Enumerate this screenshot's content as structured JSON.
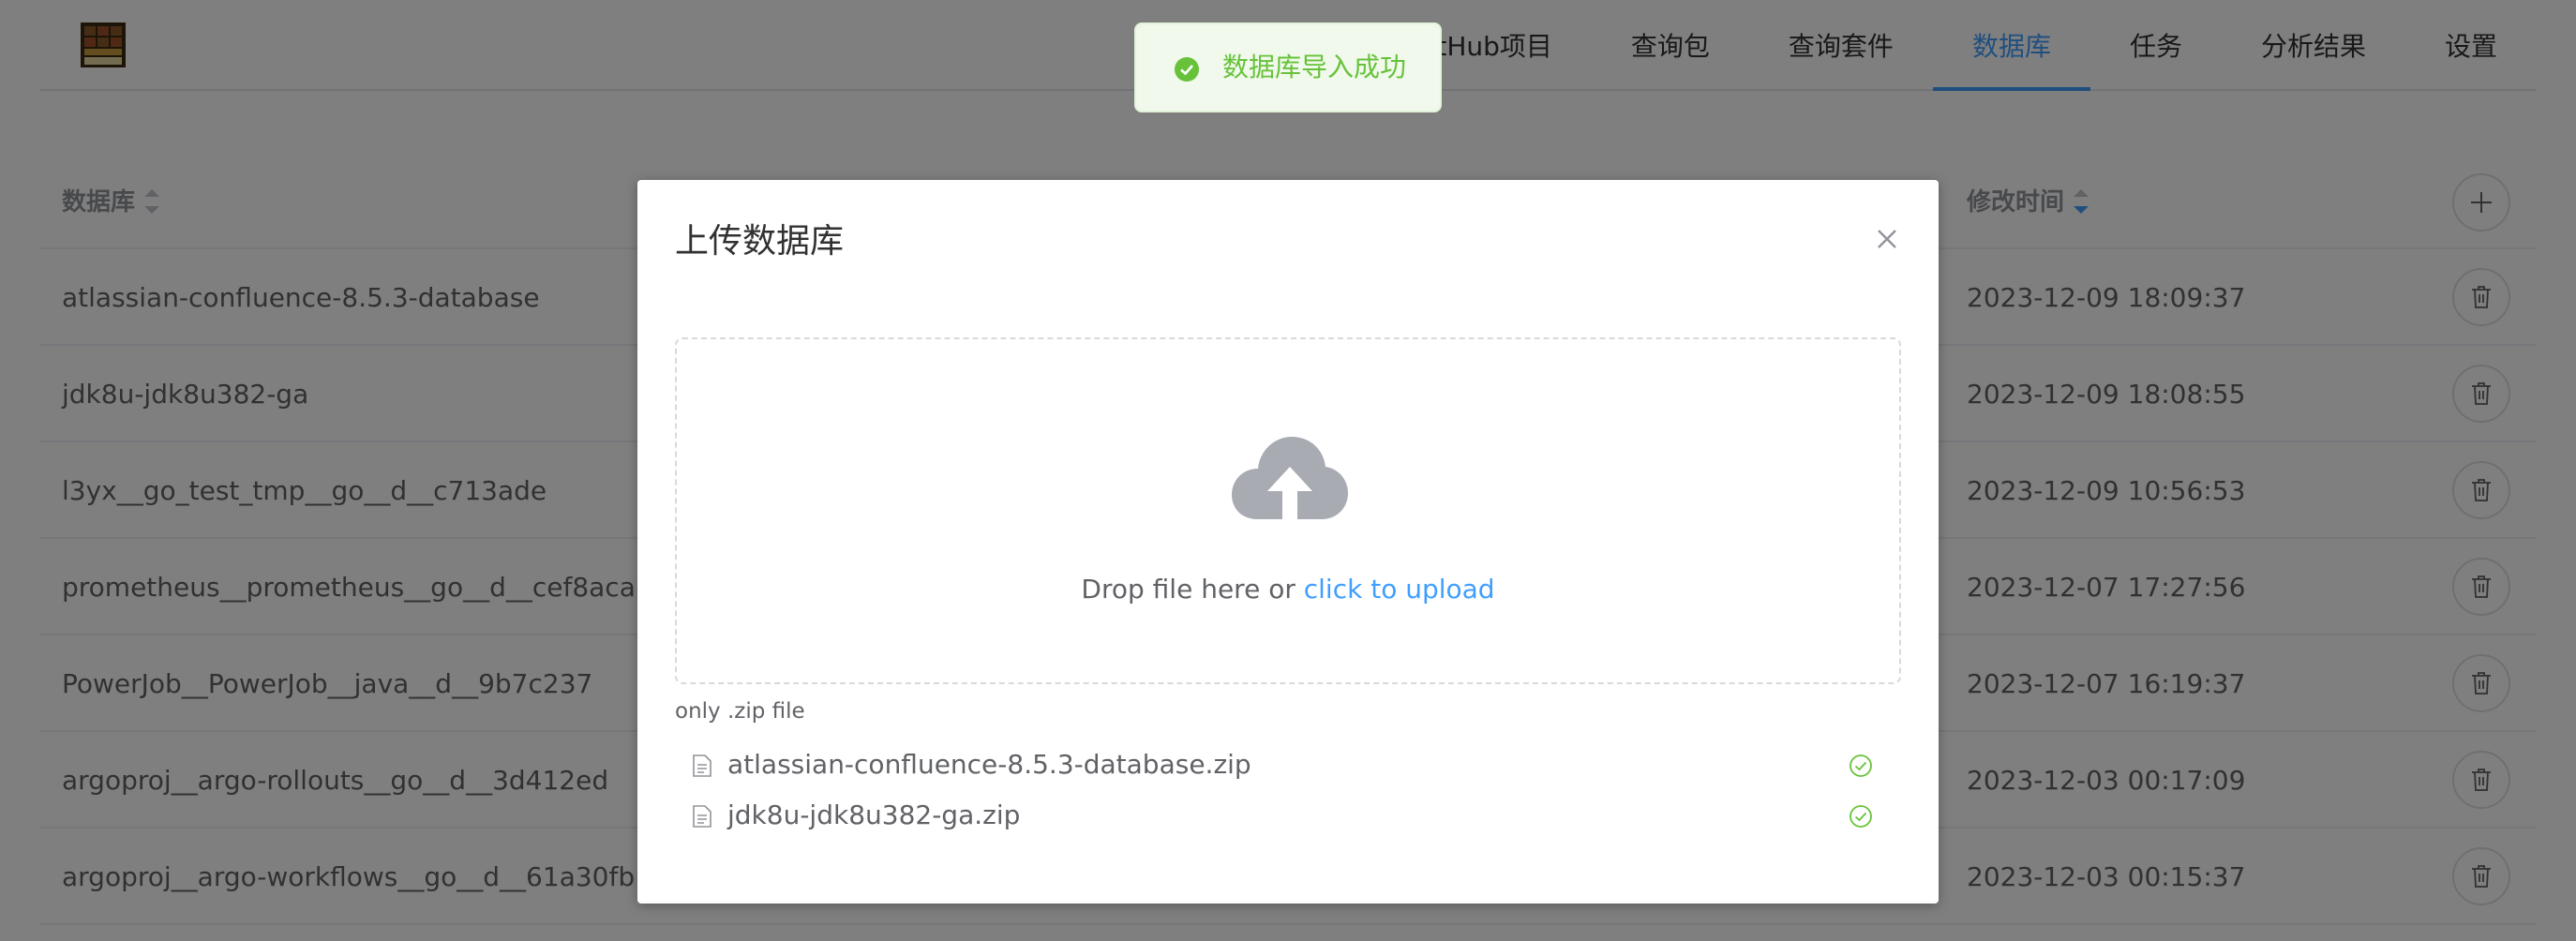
{
  "nav": {
    "items": [
      {
        "label": "GitHub项目"
      },
      {
        "label": "查询包"
      },
      {
        "label": "查询套件"
      },
      {
        "label": "数据库",
        "active": true
      },
      {
        "label": "任务"
      },
      {
        "label": "分析结果"
      },
      {
        "label": "设置"
      }
    ]
  },
  "table": {
    "columns": {
      "name": "数据库",
      "modified": "修改时间"
    },
    "rows": [
      {
        "name": "atlassian-confluence-8.5.3-database",
        "modified": "2023-12-09 18:09:37"
      },
      {
        "name": "jdk8u-jdk8u382-ga",
        "modified": "2023-12-09 18:08:55"
      },
      {
        "name": "l3yx__go_test_tmp__go__d__c713ade",
        "modified": "2023-12-09 10:56:53"
      },
      {
        "name": "prometheus__prometheus__go__d__cef8aca",
        "modified": "2023-12-07 17:27:56"
      },
      {
        "name": "PowerJob__PowerJob__java__d__9b7c237",
        "modified": "2023-12-07 16:19:37"
      },
      {
        "name": "argoproj__argo-rollouts__go__d__3d412ed",
        "modified": "2023-12-03 00:17:09"
      },
      {
        "name": "argoproj__argo-workflows__go__d__61a30fb",
        "modified": "2023-12-03 00:15:37"
      }
    ]
  },
  "dialog": {
    "title": "上传数据库",
    "drop_text": "Drop file here or",
    "click_text": "click to upload",
    "tip": "only .zip file",
    "files": [
      {
        "name": "atlassian-confluence-8.5.3-database.zip",
        "status": "success"
      },
      {
        "name": "jdk8u-jdk8u382-ga.zip",
        "status": "success"
      }
    ]
  },
  "toast": {
    "message": "数据库导入成功",
    "type": "success"
  },
  "icons": {
    "logo": "app-logo",
    "add": "plus-icon",
    "delete": "trash-icon",
    "close": "close-icon",
    "upload": "upload-cloud-icon",
    "file": "document-icon",
    "success": "circle-check-icon"
  },
  "colors": {
    "accent": "#409eff",
    "success": "#67c23a",
    "text": "#606266",
    "overlay": "rgba(0,0,0,0.5)"
  }
}
